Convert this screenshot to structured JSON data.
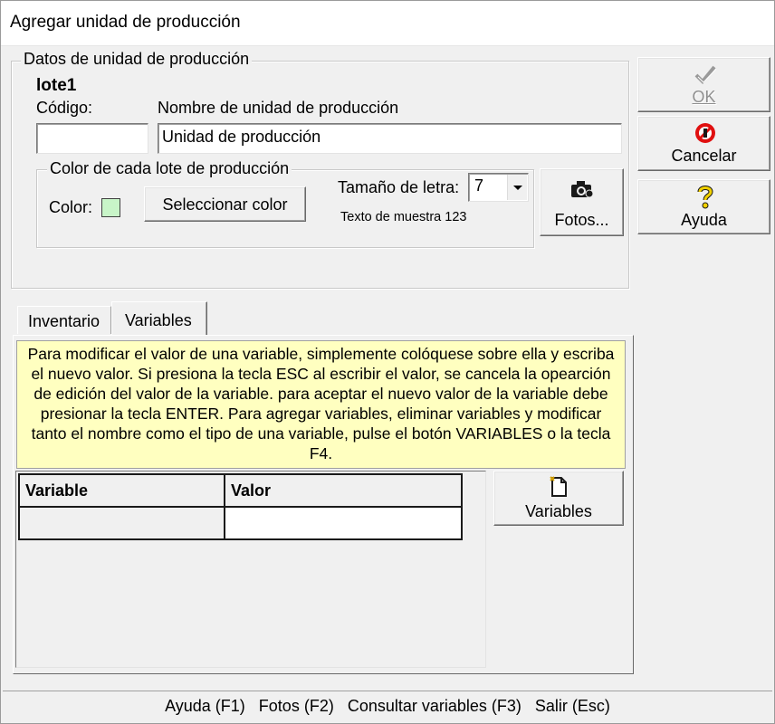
{
  "window": {
    "title": "Agregar unidad de producción"
  },
  "datos": {
    "legend": "Datos de unidad de producción",
    "lote": "lote1",
    "codigo_label": "Código:",
    "codigo_value": "",
    "nombre_label": "Nombre de unidad de producción",
    "nombre_value": "Unidad de producción"
  },
  "color_group": {
    "legend": "Color de cada lote de producción",
    "color_label": "Color:",
    "swatch_color": "#c8f5c8",
    "select_button": "Seleccionar color",
    "font_size_label": "Tamaño de letra:",
    "font_size_value": "7",
    "sample_text": "Texto de muestra 123"
  },
  "buttons": {
    "fotos": "Fotos...",
    "ok": "OK",
    "cancelar": "Cancelar",
    "ayuda": "Ayuda",
    "variables": "Variables"
  },
  "tabs": [
    {
      "label": "Inventario",
      "active": false
    },
    {
      "label": "Variables",
      "active": true
    }
  ],
  "info_text": "Para modificar el valor de una variable, simplemente colóquese sobre ella y escriba el nuevo valor. Si presiona la tecla ESC al escribir el valor, se cancela la opearción de edición del valor de la variable. para aceptar el nuevo valor de la variable debe presionar la tecla ENTER. Para agregar variables, eliminar variables y modificar tanto el nombre como el tipo de una variable, pulse el botón VARIABLES o la tecla F4.",
  "grid": {
    "columns": [
      "Variable",
      "Valor"
    ],
    "rows": [
      [
        "",
        ""
      ]
    ]
  },
  "statusbar": "Ayuda (F1)   Fotos (F2)   Consultar variables (F3)   Salir (Esc)",
  "colors": {
    "info_bg": "#ffffc0",
    "ok_check": "#9a9a9a",
    "cancel_red": "#e01010",
    "help_yellow": "#f0d000"
  }
}
